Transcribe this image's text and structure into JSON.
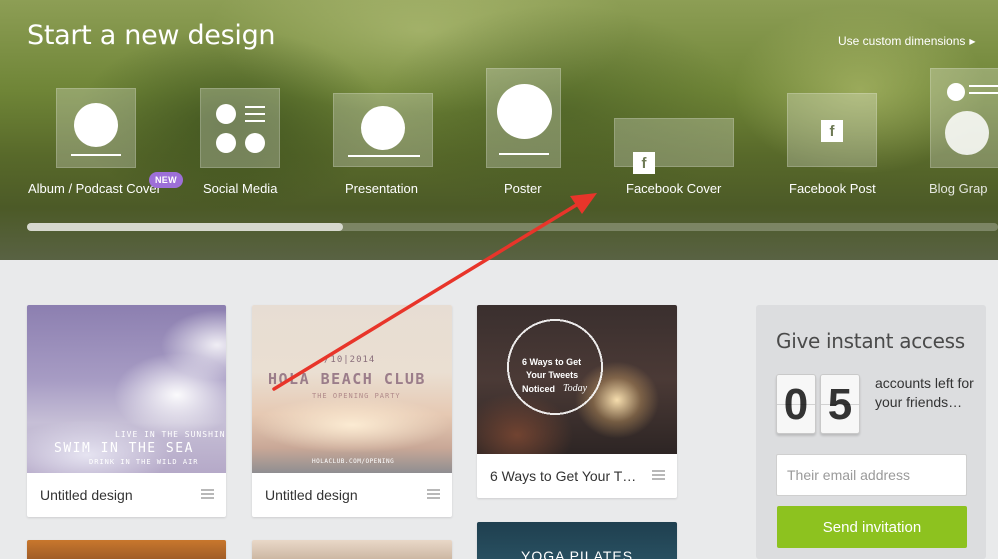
{
  "hero": {
    "title": "Start a new design",
    "custom_link": "Use custom dimensions",
    "templates": [
      {
        "label": "Album / Podcast Cover",
        "badge": "NEW"
      },
      {
        "label": "Social Media"
      },
      {
        "label": "Presentation"
      },
      {
        "label": "Poster"
      },
      {
        "label": "Facebook Cover",
        "icon_text": "f"
      },
      {
        "label": "Facebook Post",
        "icon_text": "f"
      },
      {
        "label": "Blog Grap"
      }
    ]
  },
  "designs": [
    {
      "title": "Untitled design",
      "overlay": {
        "line1": "LIVE IN THE SUNSHINE",
        "line2": "SWIM IN THE SEA",
        "line3": "DRINK IN THE WILD AIR"
      }
    },
    {
      "title": "Untitled design",
      "overlay": {
        "date": "/10|2014",
        "headline": "HOLA BEACH CLUB",
        "sub": "THE OPENING PARTY",
        "footer": "HOLACLUB.COM/OPENING"
      }
    },
    {
      "title": "6 Ways to Get Your T…",
      "overlay": {
        "line1": "6 Ways to Get",
        "line2": "Your Tweets",
        "line3": "Noticed",
        "line4": "Today"
      }
    },
    {
      "overlay": {
        "line1": "YOGA PILATES"
      }
    }
  ],
  "invite": {
    "title": "Give instant access",
    "digits": [
      "0",
      "5"
    ],
    "accounts_text": "accounts left for your friends…",
    "email_placeholder": "Their email address",
    "send_label": "Send invitation"
  },
  "colors": {
    "accent_green": "#8dc21f",
    "badge_purple": "#9d6fd8",
    "annotation_arrow": "#e8352a"
  }
}
